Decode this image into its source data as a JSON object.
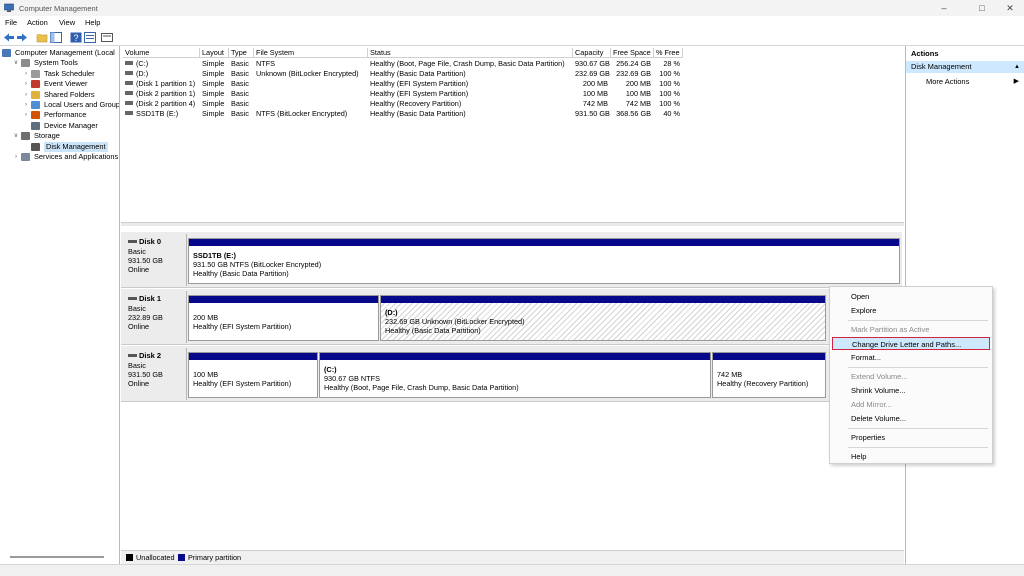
{
  "window": {
    "title": "Computer Management"
  },
  "menu": [
    "File",
    "Action",
    "View",
    "Help"
  ],
  "tree": [
    {
      "label": "Computer Management (Local",
      "level": 0,
      "expander": "",
      "icon": "computer-icon"
    },
    {
      "label": "System Tools",
      "level": 1,
      "expander": "v",
      "icon": "tools-icon"
    },
    {
      "label": "Task Scheduler",
      "level": 2,
      "expander": ">",
      "icon": "clock-icon"
    },
    {
      "label": "Event Viewer",
      "level": 2,
      "expander": ">",
      "icon": "event-viewer-icon"
    },
    {
      "label": "Shared Folders",
      "level": 2,
      "expander": ">",
      "icon": "folder-icon"
    },
    {
      "label": "Local Users and Groups",
      "level": 2,
      "expander": ">",
      "icon": "users-icon"
    },
    {
      "label": "Performance",
      "level": 2,
      "expander": ">",
      "icon": "performance-icon"
    },
    {
      "label": "Device Manager",
      "level": 2,
      "expander": "",
      "icon": "device-manager-icon"
    },
    {
      "label": "Storage",
      "level": 1,
      "expander": "v",
      "icon": "storage-icon"
    },
    {
      "label": "Disk Management",
      "level": 2,
      "expander": "",
      "icon": "disk-icon",
      "selected": true
    },
    {
      "label": "Services and Applications",
      "level": 1,
      "expander": ">",
      "icon": "services-icon"
    }
  ],
  "volume_table": {
    "headers": [
      "Volume",
      "Layout",
      "Type",
      "File System",
      "Status",
      "Capacity",
      "Free Space",
      "% Free"
    ],
    "rows": [
      [
        "(C:)",
        "Simple",
        "Basic",
        "NTFS",
        "Healthy (Boot, Page File, Crash Dump, Basic Data Partition)",
        "930.67 GB",
        "256.24 GB",
        "28 %"
      ],
      [
        "(D:)",
        "Simple",
        "Basic",
        "Unknown (BitLocker Encrypted)",
        "Healthy (Basic Data Partition)",
        "232.69 GB",
        "232.69 GB",
        "100 %"
      ],
      [
        "(Disk 1 partition 1)",
        "Simple",
        "Basic",
        "",
        "Healthy (EFI System Partition)",
        "200 MB",
        "200 MB",
        "100 %"
      ],
      [
        "(Disk 2 partition 1)",
        "Simple",
        "Basic",
        "",
        "Healthy (EFI System Partition)",
        "100 MB",
        "100 MB",
        "100 %"
      ],
      [
        "(Disk 2 partition 4)",
        "Simple",
        "Basic",
        "",
        "Healthy (Recovery Partition)",
        "742 MB",
        "742 MB",
        "100 %"
      ],
      [
        "SSD1TB (E:)",
        "Simple",
        "Basic",
        "NTFS (BitLocker Encrypted)",
        "Healthy (Basic Data Partition)",
        "931.50 GB",
        "368.56 GB",
        "40 %"
      ]
    ]
  },
  "disks": [
    {
      "name": "Disk 0",
      "type": "Basic",
      "size": "931.50 GB",
      "status": "Online",
      "partitions": [
        {
          "name": "SSD1TB  (E:)",
          "line1": "931.50 GB NTFS (BitLocker Encrypted)",
          "line2": "Healthy (Basic Data Partition)"
        }
      ]
    },
    {
      "name": "Disk 1",
      "type": "Basic",
      "size": "232.89 GB",
      "status": "Online",
      "partitions": [
        {
          "name": "",
          "line1": "200 MB",
          "line2": "Healthy (EFI System Partition)"
        },
        {
          "name": "(D:)",
          "line1": "232.69 GB Unknown (BitLocker Encrypted)",
          "line2": "Healthy (Basic Data Partition)"
        }
      ]
    },
    {
      "name": "Disk 2",
      "type": "Basic",
      "size": "931.50 GB",
      "status": "Online",
      "partitions": [
        {
          "name": "",
          "line1": "100 MB",
          "line2": "Healthy (EFI System Partition)"
        },
        {
          "name": "(C:)",
          "line1": "930.67 GB NTFS",
          "line2": "Healthy (Boot, Page File, Crash Dump, Basic Data Partition)"
        },
        {
          "name": "",
          "line1": "742 MB",
          "line2": "Healthy (Recovery Partition)"
        }
      ]
    }
  ],
  "legend": [
    {
      "label": "Unallocated",
      "color": "#000000"
    },
    {
      "label": "Primary partition",
      "color": "#08088a"
    }
  ],
  "actions": {
    "header": "Actions",
    "section": "Disk Management",
    "more": "More Actions"
  },
  "context_menu": [
    {
      "label": "Open",
      "disabled": false
    },
    {
      "label": "Explore",
      "disabled": false
    },
    {
      "sep": true
    },
    {
      "label": "Mark Partition as Active",
      "disabled": true
    },
    {
      "label": "Change Drive Letter and Paths...",
      "disabled": false,
      "highlighted": true
    },
    {
      "label": "Format...",
      "disabled": false
    },
    {
      "sep": true
    },
    {
      "label": "Extend Volume...",
      "disabled": true
    },
    {
      "label": "Shrink Volume...",
      "disabled": false
    },
    {
      "label": "Add Mirror...",
      "disabled": true
    },
    {
      "label": "Delete Volume...",
      "disabled": false
    },
    {
      "sep": true
    },
    {
      "label": "Properties",
      "disabled": false
    },
    {
      "sep": true
    },
    {
      "label": "Help",
      "disabled": false
    }
  ],
  "colors": {
    "primary_partition": "#08088a",
    "selection": "#cde8ff",
    "highlight_border": "#d2233f"
  }
}
